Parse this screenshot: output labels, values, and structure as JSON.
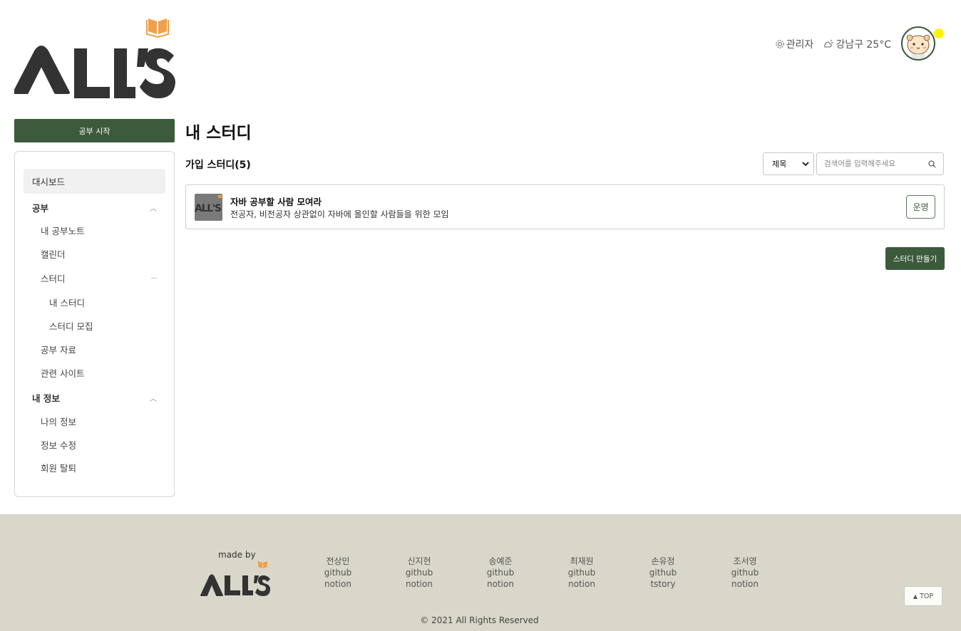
{
  "brand": {
    "logo_text": "ALL'S",
    "accent": "#3c5a3c",
    "orange": "#f0a04b"
  },
  "header": {
    "admin_label": "관리자",
    "weather_label": "강남구 25°C"
  },
  "sidebar": {
    "start_button": "공부 시작",
    "dashboard": "대시보드",
    "study_group": "공부",
    "items": {
      "my_notes": "내 공부노트",
      "calendar": "캘린더",
      "study": "스터디",
      "my_study": "내 스터디",
      "recruit": "스터디 모집",
      "materials": "공부 자료",
      "sites": "관련 사이트"
    },
    "info_group": "내 정보",
    "info_items": {
      "my_info": "나의 정보",
      "edit_info": "정보 수정",
      "withdraw": "회원 탈퇴"
    }
  },
  "main": {
    "title": "내 스터디",
    "section_title": "가입 스터디(5)",
    "filter_value": "제목",
    "search_placeholder": "검색어를 입력해주세요",
    "study": {
      "name": "자바 공부할 사람 모여라",
      "description": "전공자, 비전공자 상관없이 자바에 올인할 사람들을 위한 모임",
      "role": "운영"
    },
    "create_button": "스터디 만들기"
  },
  "footer": {
    "made_by": "made by",
    "members": [
      {
        "name": "전상민",
        "link1": "github",
        "link2": "notion"
      },
      {
        "name": "신지현",
        "link1": "github",
        "link2": "notion"
      },
      {
        "name": "송예준",
        "link1": "github",
        "link2": "notion"
      },
      {
        "name": "최재원",
        "link1": "github",
        "link2": "notion"
      },
      {
        "name": "손유정",
        "link1": "github",
        "link2": "tstory"
      },
      {
        "name": "조서영",
        "link1": "github",
        "link2": "notion"
      }
    ],
    "copyright": "© 2021 All Rights Reserved",
    "top_button": "TOP"
  }
}
